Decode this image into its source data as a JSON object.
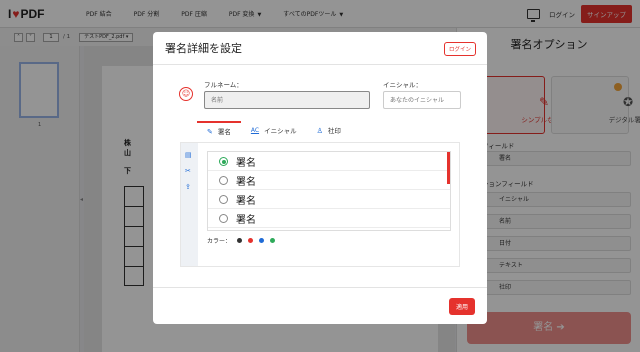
{
  "nav": {
    "logo_left": "I",
    "logo_right": "PDF",
    "links": [
      "PDF 結合",
      "PDF 分割",
      "PDF 圧縮",
      "PDF 変換",
      "すべてのPDFツール"
    ],
    "login": "ログイン",
    "signup": "サインアップ"
  },
  "toolbar": {
    "page_value": "1",
    "page_total": "/ 1",
    "file_name": "テストPDF_2.pdf"
  },
  "thumbs": {
    "page_number": "1"
  },
  "document": {
    "line1": "株",
    "line2": "山",
    "line3": "下"
  },
  "right_panel": {
    "title": "署名オプション",
    "card_simple": "シンプルな署名",
    "card_digital": "デジタル署名",
    "section_required": "必須フィールド",
    "required_items": [
      "署名"
    ],
    "section_optional": "オプションフィールド",
    "optional_items": [
      "イニシャル",
      "名前",
      "日付",
      "テキスト",
      "社印"
    ],
    "sign_button": "署名"
  },
  "modal": {
    "title": "署名詳細を設定",
    "login": "ログイン",
    "fullname_label": "フルネーム：",
    "fullname_placeholder": "名前",
    "initial_label": "イニシャル：",
    "initial_placeholder": "あなたのイニシャル",
    "tabs": [
      {
        "icon": "pen-icon",
        "label": "署名"
      },
      {
        "icon": "initials-icon",
        "label": "イニシャル"
      },
      {
        "icon": "stamp-icon",
        "label": "社印"
      }
    ],
    "signatures": [
      "署名",
      "署名",
      "署名",
      "署名"
    ],
    "selected_index": 0,
    "color_label": "カラー：",
    "colors": [
      "#333333",
      "#e5322d",
      "#1f6bd6",
      "#2eaa5a"
    ],
    "apply": "適用"
  }
}
